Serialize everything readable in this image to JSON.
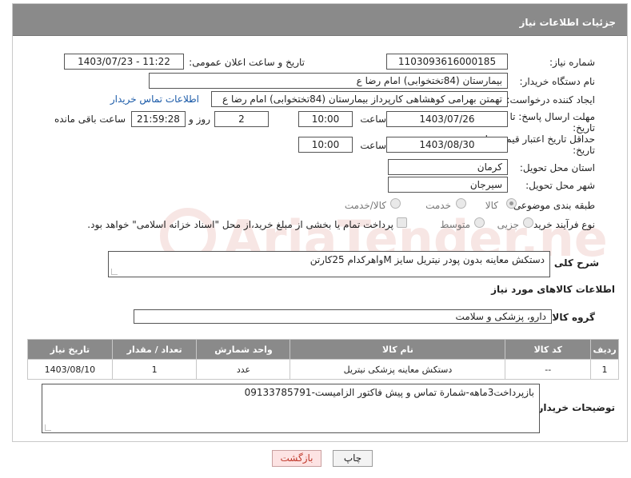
{
  "header": {
    "title": "جزئیات اطلاعات نیاز"
  },
  "fields": {
    "need_number_label": "شماره نیاز:",
    "need_number": "1103093616000185",
    "announce_label": "تاریخ و ساعت اعلان عمومی:",
    "announce_value": "1403/07/23 - 11:22",
    "buyer_org_label": "نام دستگاه خریدار:",
    "buyer_org": "بیمارستان (84تختخوابی) امام رضا  ع",
    "creator_label": "ایجاد کننده درخواست:",
    "creator": "تهمتن بهرامی کوهشاهی کارپرداز بیمارستان (84تختخوابی) امام رضا  ع",
    "contact_link": "اطلاعات تماس خریدار",
    "deadline_label_1": "مهلت ارسال پاسخ: تا",
    "deadline_label_2": "تاریخ:",
    "deadline_date": "1403/07/26",
    "time_label": "ساعت",
    "deadline_time": "10:00",
    "days_value": "2",
    "days_label": "روز و",
    "remaining_time": "21:59:28",
    "remaining_label": "ساعت باقی مانده",
    "validity_label_1": "حداقل تاریخ اعتبار قیمت: تا",
    "validity_label_2": "تاریخ:",
    "validity_date": "1403/08/30",
    "validity_time": "10:00",
    "province_label": "استان محل تحویل:",
    "province": "کرمان",
    "city_label": "شهر محل تحویل:",
    "city": "سیرجان",
    "category_label": "طبقه بندی موضوعی:",
    "category_options": [
      "کالا",
      "خدمت",
      "کالا/خدمت"
    ],
    "process_label": "نوع فرآیند خرید :",
    "process_options": [
      "جزیی",
      "متوسط"
    ],
    "payment_note": "پرداخت تمام یا بخشی از مبلغ خرید،از محل \"اسناد خزانه اسلامی\" خواهد بود.",
    "summary_label": "شرح کلی نیاز:",
    "summary": "دستکش معاینه بدون پودر نیتریل سایز Mوlهرکدام 25کارتن",
    "goods_info_title": "اطلاعات کالاهای مورد نیاز",
    "goods_group_label": "گروه کالا:",
    "goods_group": "دارو، پزشکی و سلامت",
    "buyer_notes_label": "توضیحات خریدار:",
    "buyer_notes": "بازپرداخت3ماهه-شمارة تماس و پیش فاکتور الزامیست-09133785791"
  },
  "table": {
    "headers": [
      "ردیف",
      "کد کالا",
      "نام کالا",
      "واحد شمارش",
      "تعداد / مقدار",
      "تاریخ نیاز"
    ],
    "rows": [
      [
        "1",
        "--",
        "دستکش معاینه پزشکی نیتریل",
        "عدد",
        "1",
        "1403/08/10"
      ]
    ]
  },
  "buttons": {
    "print": "چاپ",
    "back": "بازگشت"
  },
  "watermark": {
    "text": "AriaTender.net"
  }
}
